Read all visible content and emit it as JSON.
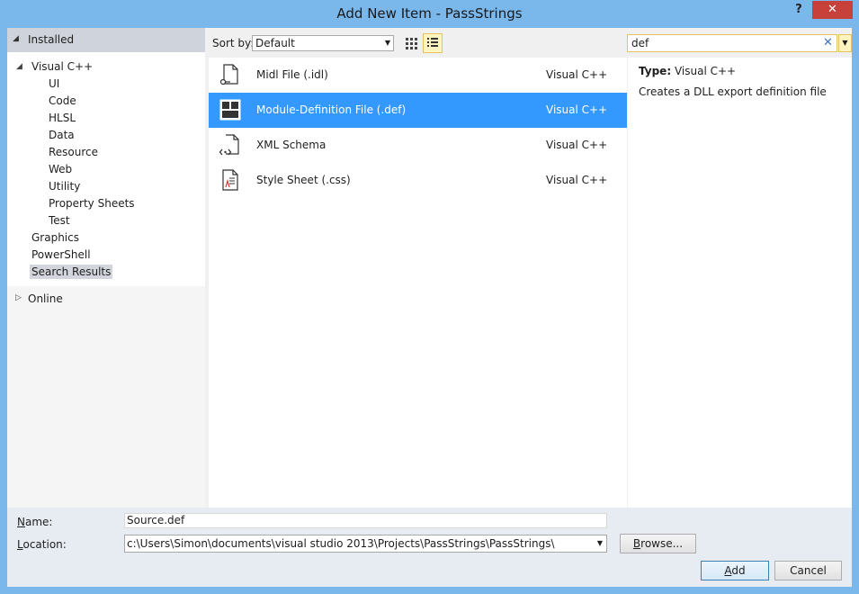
{
  "window": {
    "title": "Add New Item - PassStrings",
    "help_label": "?",
    "close_label": "✕"
  },
  "tree": {
    "header": "Installed",
    "root": "Visual C++",
    "children": [
      "UI",
      "Code",
      "HLSL",
      "Data",
      "Resource",
      "Web",
      "Utility",
      "Property Sheets",
      "Test"
    ],
    "siblings": [
      "Graphics",
      "PowerShell",
      "Search Results"
    ],
    "selected": "Search Results",
    "online": "Online"
  },
  "toolbar": {
    "sort_label": "Sort by:",
    "sort_value": "Default",
    "search_value": "def",
    "active_view": "list"
  },
  "items": [
    {
      "name": "Midl File (.idl)",
      "lang": "Visual C++",
      "icon": "midl-file-icon",
      "selected": false
    },
    {
      "name": "Module-Definition File (.def)",
      "lang": "Visual C++",
      "icon": "module-definition-file-icon",
      "selected": true
    },
    {
      "name": "XML Schema",
      "lang": "Visual C++",
      "icon": "xml-schema-icon",
      "selected": false
    },
    {
      "name": "Style Sheet (.css)",
      "lang": "Visual C++",
      "icon": "style-sheet-icon",
      "selected": false
    }
  ],
  "details": {
    "type_label": "Type:",
    "type_value": "Visual C++",
    "description": "Creates a DLL export definition file"
  },
  "bottom": {
    "name_label_prefix": "N",
    "name_label_rest": "ame:",
    "name_value": "Source.def",
    "location_label_prefix": "L",
    "location_label_rest": "ocation:",
    "location_value": "c:\\Users\\Simon\\documents\\visual studio 2013\\Projects\\PassStrings\\PassStrings\\",
    "browse_prefix": "B",
    "browse_rest": "rowse...",
    "add_prefix": "A",
    "add_rest": "dd",
    "cancel_label": "Cancel"
  },
  "colors": {
    "selection": "#3399ff",
    "titlebar": "#7ab7ea",
    "close_button": "#c7413a"
  }
}
